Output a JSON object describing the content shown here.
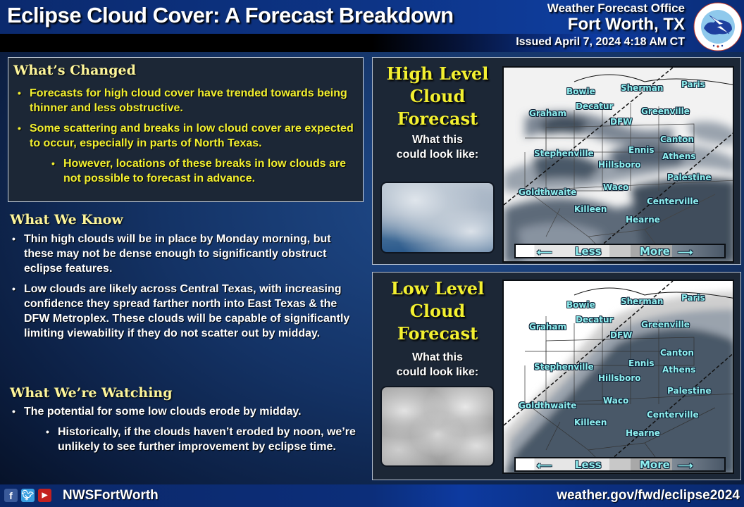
{
  "header": {
    "title": "Eclipse Cloud Cover: A Forecast Breakdown",
    "office_line1": "Weather Forecast Office",
    "office_line2": "Fort Worth, TX",
    "issued": "Issued April 7, 2024 4:18 AM CT",
    "logo_icon": "nws-logo-icon",
    "logo_text": "NATIONAL WEATHER SERVICE"
  },
  "whats_changed": {
    "heading": "What’s Changed",
    "bullets": [
      "Forecasts for high cloud cover have trended towards being thinner and less obstructive.",
      "Some scattering and breaks in low cloud cover are expected to occur, especially in parts of North Texas.",
      "However, locations of these breaks in low clouds are not possible to forecast in advance."
    ]
  },
  "what_we_know": {
    "heading": "What We Know",
    "bullets": [
      "Thin high clouds will be in place by Monday morning, but these may not be dense enough to significantly obstruct eclipse features.",
      "Low clouds are likely across Central Texas, with increasing confidence they spread farther north into East Texas & the DFW Metroplex. These clouds will be capable of significantly limiting viewability if they do not scatter out by midday."
    ]
  },
  "what_were_watching": {
    "heading": "What We’re Watching",
    "bullets": [
      "The potential for some low clouds erode by midday.",
      "Historically, if the clouds haven’t eroded by noon, we’re unlikely to see further improvement by eclipse time."
    ]
  },
  "high_panel": {
    "title_line1": "High Level",
    "title_line2": "Cloud",
    "title_line3": "Forecast",
    "sub_line1": "What this",
    "sub_line2": "could look like:"
  },
  "low_panel": {
    "title_line1": "Low Level",
    "title_line2": "Cloud",
    "title_line3": "Forecast",
    "sub_line1": "What this",
    "sub_line2": "could look like:"
  },
  "map": {
    "cities": [
      "Bowie",
      "Sherman",
      "Paris",
      "Graham",
      "Decatur",
      "Greenville",
      "DFW",
      "Canton",
      "Stephenville",
      "Ennis",
      "Athens",
      "Hillsboro",
      "Palestine",
      "Goldthwaite",
      "Waco",
      "Centerville",
      "Killeen",
      "Hearne"
    ],
    "legend_less": "Less",
    "legend_more": "More"
  },
  "footer": {
    "social_icons": [
      "facebook-icon",
      "twitter-icon",
      "youtube-icon"
    ],
    "handle": "NWSFortWorth",
    "url": "weather.gov/fwd/eclipse2024"
  },
  "colors": {
    "heading_yellow": "#fdf59a",
    "bullet_yellow": "#f3f030",
    "city_label": "#8ff0f0",
    "panel_bg": "#1c2736"
  }
}
